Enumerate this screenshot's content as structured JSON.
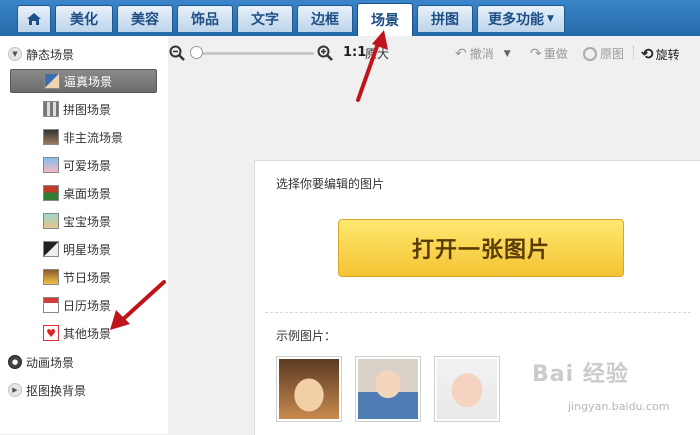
{
  "top_tabs": [
    {
      "label": "",
      "icon": "home-icon"
    },
    {
      "label": "美化"
    },
    {
      "label": "美容"
    },
    {
      "label": "饰品"
    },
    {
      "label": "文字"
    },
    {
      "label": "边框"
    },
    {
      "label": "场景",
      "active": true
    },
    {
      "label": "拼图"
    },
    {
      "label": "更多功能"
    }
  ],
  "left_panel": {
    "groups": [
      {
        "label": "静态场景",
        "expanded": true
      },
      {
        "label": "动画场景",
        "expanded": false
      },
      {
        "label": "抠图换背景",
        "expanded": false
      }
    ],
    "items": [
      {
        "label": "逼真场景",
        "selected": true,
        "icon": "realistic-scene-icon"
      },
      {
        "label": "拼图场景",
        "icon": "collage-scene-icon"
      },
      {
        "label": "非主流场景",
        "icon": "nonmainstream-scene-icon"
      },
      {
        "label": "可爱场景",
        "icon": "cute-scene-icon"
      },
      {
        "label": "桌面场景",
        "icon": "desktop-scene-icon"
      },
      {
        "label": "宝宝场景",
        "icon": "baby-scene-icon"
      },
      {
        "label": "明星场景",
        "icon": "star-scene-icon"
      },
      {
        "label": "节日场景",
        "icon": "festival-scene-icon"
      },
      {
        "label": "日历场景",
        "icon": "calendar-scene-icon"
      },
      {
        "label": "其他场景",
        "icon": "heart-scene-icon"
      }
    ]
  },
  "toolbar": {
    "zoom_ratio_label": "1:1",
    "original_size_label": "原大",
    "undo_label": "撤消",
    "redo_label": "重做",
    "original_label": "原图",
    "rotate_label": "旋转"
  },
  "main": {
    "prompt": "选择你要编辑的图片",
    "open_button": "打开一张图片",
    "samples_label": "示例图片："
  },
  "watermark": {
    "text": "Bai 经验",
    "url": "jingyan.baidu.com"
  },
  "colors": {
    "topbar": "#2569a8",
    "open_button": "#f4c334",
    "arrow": "#c0141c"
  }
}
